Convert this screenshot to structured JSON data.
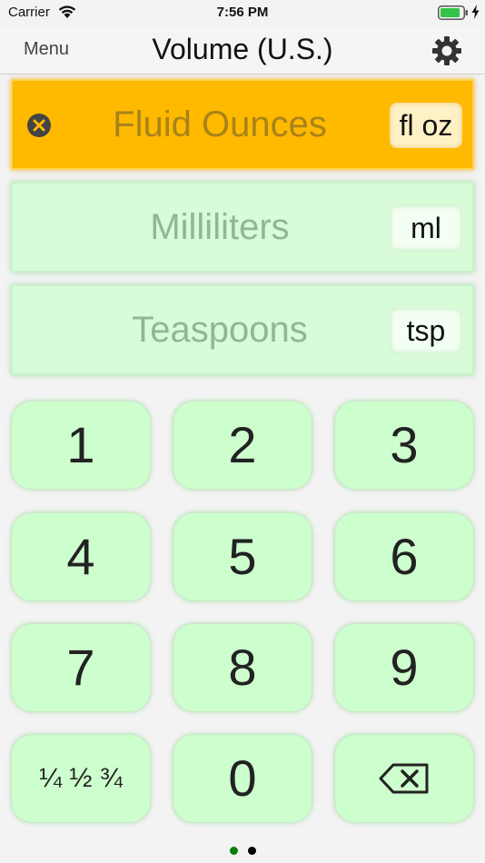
{
  "status_bar": {
    "carrier": "Carrier",
    "time": "7:56 PM"
  },
  "nav": {
    "menu_label": "Menu",
    "title": "Volume (U.S.)",
    "settings_icon": "gear-icon"
  },
  "units": [
    {
      "name": "Fluid Ounces",
      "abbr": "fl oz",
      "active": true
    },
    {
      "name": "Milliliters",
      "abbr": "ml",
      "active": false
    },
    {
      "name": "Teaspoons",
      "abbr": "tsp",
      "active": false
    }
  ],
  "keypad": {
    "keys": [
      "1",
      "2",
      "3",
      "4",
      "5",
      "6",
      "7",
      "8",
      "9",
      "¼ ½ ¾",
      "0"
    ],
    "backspace_icon": "backspace-icon"
  },
  "pager": {
    "page_count": 2,
    "current_page": 1
  },
  "colors": {
    "active_row": "#ffba00",
    "row": "#d8fbd8",
    "key": "#cdfecd",
    "dot_active": "#0a7d0a",
    "dot_inactive": "#000000"
  }
}
